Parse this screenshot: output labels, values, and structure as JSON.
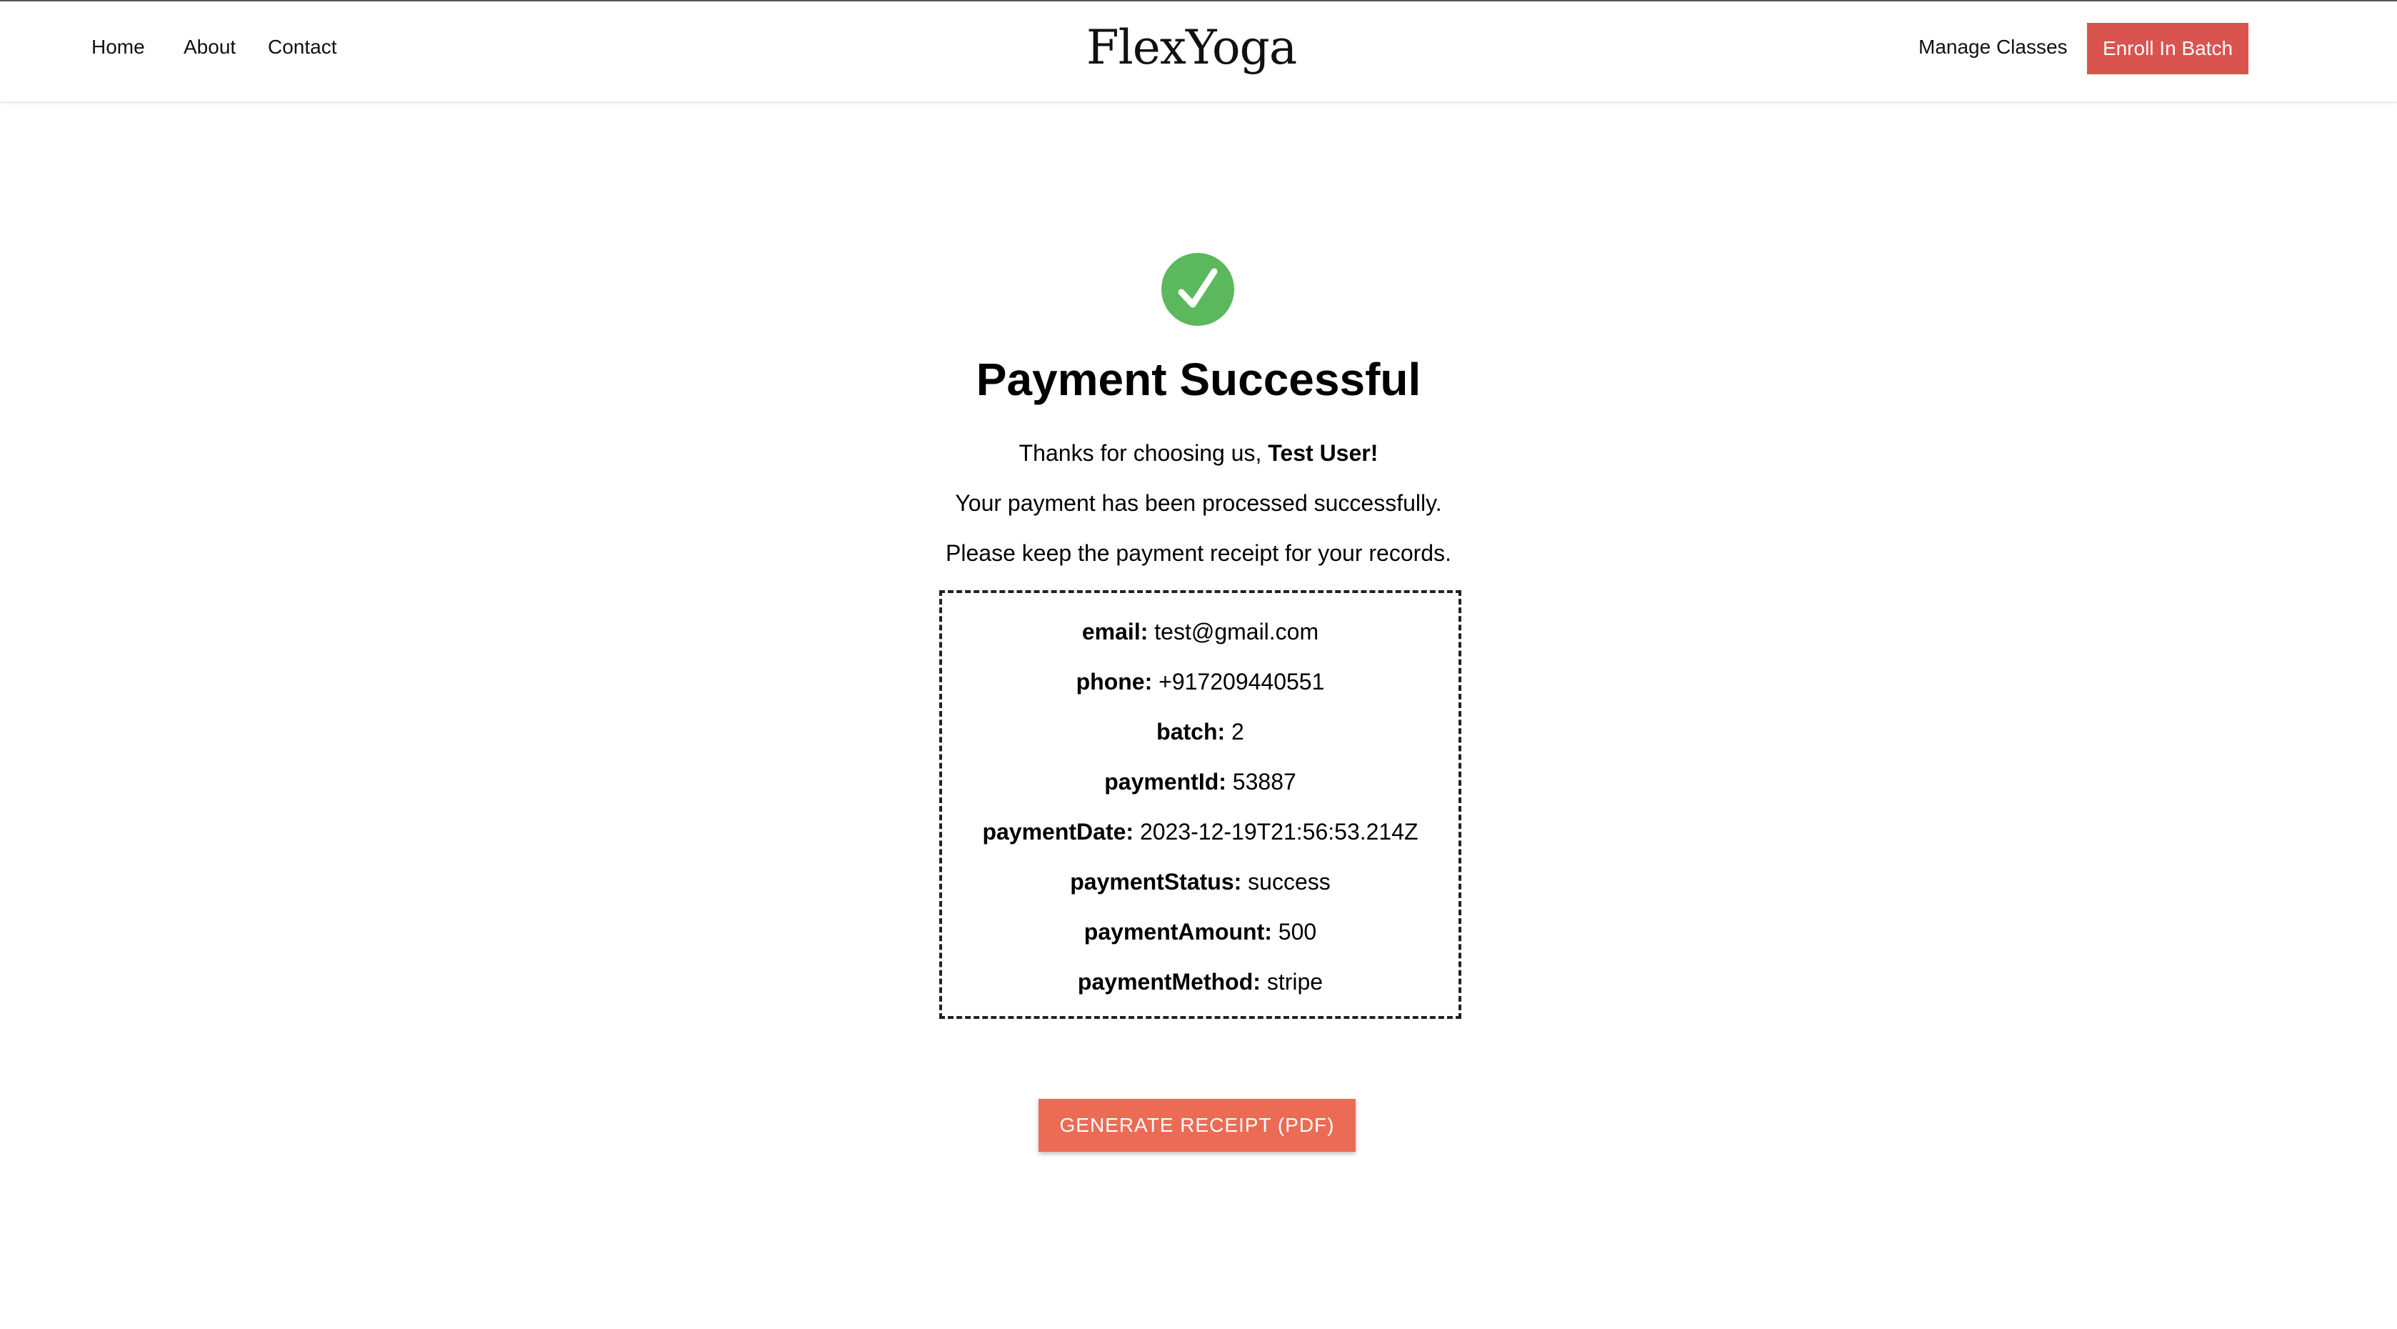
{
  "navbar": {
    "links": [
      "Home",
      "About",
      "Contact"
    ],
    "brand": "FlexYoga",
    "manage_label": "Manage Classes",
    "enroll_label": "Enroll In Batch"
  },
  "main": {
    "icon": "check-circle-icon",
    "title": "Payment Successful",
    "thanks_prefix": "Thanks for choosing us,",
    "user_name": "Test User!",
    "processed_text": "Your payment has been processed successfully.",
    "keep_text": "Please keep the payment receipt for your records.",
    "receipt": [
      {
        "key": "email:",
        "value": "test@gmail.com"
      },
      {
        "key": "phone:",
        "value": "+917209440551"
      },
      {
        "key": "batch:",
        "value": "2"
      },
      {
        "key": "paymentId:",
        "value": "53887"
      },
      {
        "key": "paymentDate:",
        "value": "2023-12-19T21:56:53.214Z"
      },
      {
        "key": "paymentStatus:",
        "value": "success"
      },
      {
        "key": "paymentAmount:",
        "value": "500"
      },
      {
        "key": "paymentMethod:",
        "value": "stripe"
      }
    ],
    "generate_label": "GENERATE RECEIPT (PDF)"
  },
  "colors": {
    "enroll_button": "#d9534f",
    "generate_button": "#ec6b55",
    "success_icon": "#5cb85c"
  }
}
